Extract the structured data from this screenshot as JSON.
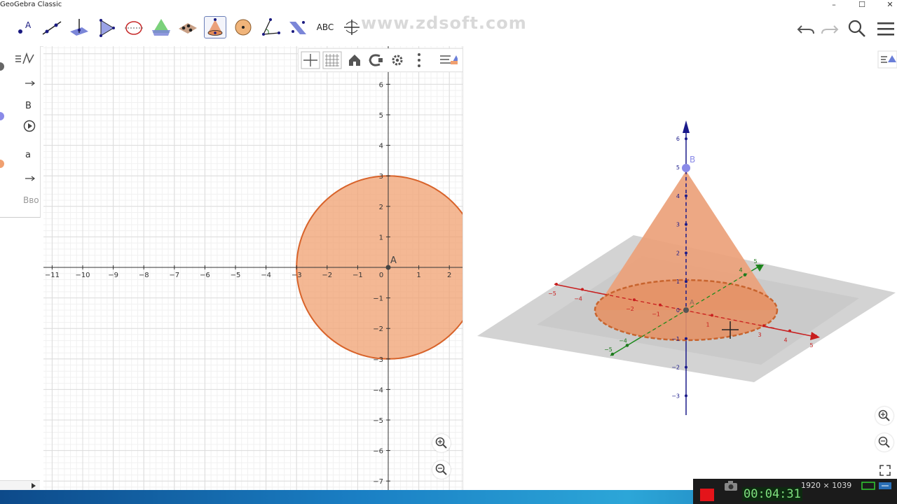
{
  "window": {
    "title": "GeoGebra Classic",
    "controls": [
      "–",
      "☐",
      "✕"
    ]
  },
  "watermark": "www.zdsoft.com",
  "toolbar": {
    "tools": [
      {
        "name": "point-tool-icon",
        "active": false
      },
      {
        "name": "line-tool-icon",
        "active": false
      },
      {
        "name": "perpendicular-plane-tool-icon",
        "active": false
      },
      {
        "name": "pyramid-tool-icon",
        "active": false
      },
      {
        "name": "circle-axis-tool-icon",
        "active": false
      },
      {
        "name": "intersect-surfaces-tool-icon",
        "active": false
      },
      {
        "name": "plane-tool-icon",
        "active": false
      },
      {
        "name": "cone-tool-icon",
        "active": true
      },
      {
        "name": "sphere-tool-icon",
        "active": false
      },
      {
        "name": "angle-tool-icon",
        "active": false
      },
      {
        "name": "reflect-plane-tool-icon",
        "active": false
      },
      {
        "name": "text-tool-icon",
        "active": false
      },
      {
        "name": "rotate-view-tool-icon",
        "active": false
      }
    ],
    "text_tool_label": "ABC"
  },
  "algebra": {
    "input_placeholder": "Вво",
    "items": [
      {
        "label": "B",
        "color": "#6666dd"
      },
      {
        "label": "a",
        "color": "#e8904c"
      }
    ]
  },
  "graphics2d": {
    "point_label": "A",
    "x_ticks": [
      "−11",
      "−10",
      "−9",
      "−8",
      "−7",
      "−6",
      "−5",
      "−4",
      "−3",
      "−2",
      "−1",
      "0",
      "1",
      "2"
    ],
    "y_ticks_pos": [
      "6",
      "5",
      "4",
      "3",
      "2",
      "1"
    ],
    "y_ticks_neg": [
      "−1",
      "−2",
      "−3",
      "−4",
      "−5",
      "−6",
      "−7"
    ],
    "circle": {
      "center": [
        0,
        0
      ],
      "radius": 3,
      "fill": "#f0a070",
      "stroke": "#d8632a"
    }
  },
  "graphics3d": {
    "point_labels": [
      "B",
      "A"
    ],
    "z_ticks": [
      "6",
      "5",
      "4",
      "3",
      "2",
      "1",
      "0",
      "−1",
      "−2",
      "−3"
    ],
    "x_ticks": [
      "−5",
      "−4",
      "−2",
      "−1",
      "1",
      "3",
      "4",
      "5"
    ],
    "y_ticks": [
      "5",
      "4",
      "−4",
      "−5"
    ],
    "cone": {
      "apex_height": 5,
      "base_radius": 3,
      "fill": "#eba17a",
      "stroke": "#c8642e"
    }
  },
  "recorder": {
    "timer": "00:04:31",
    "resolution": "1920 × 1039"
  }
}
